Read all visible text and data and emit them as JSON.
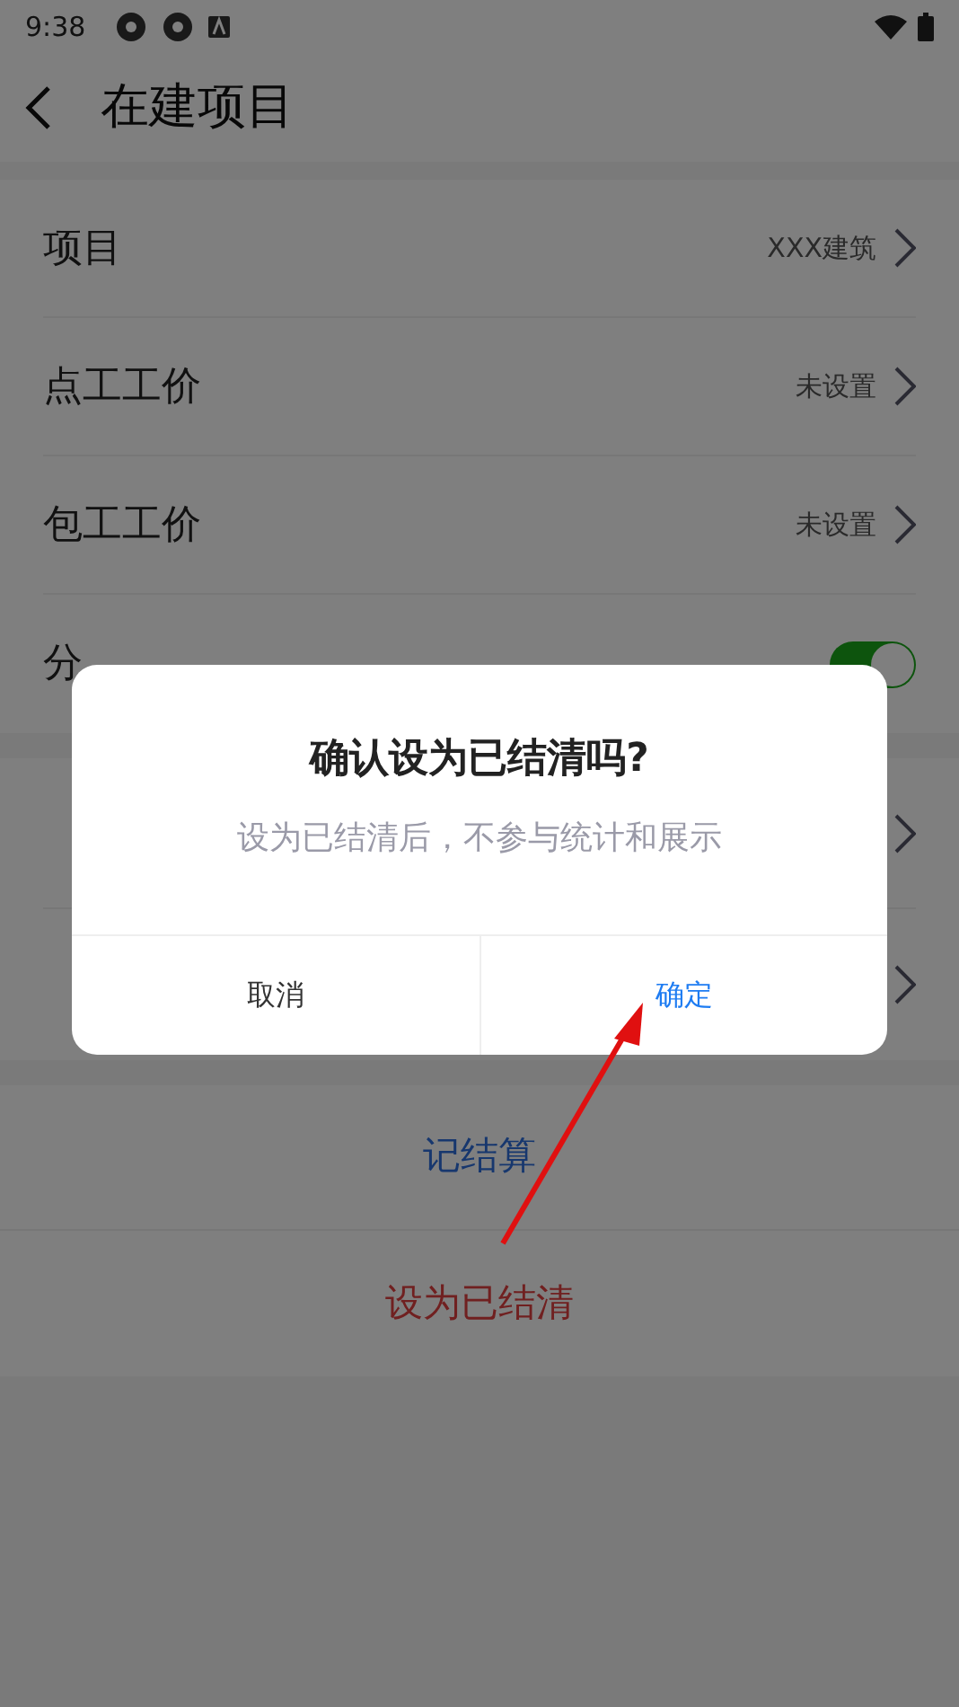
{
  "status_bar": {
    "time": "9:38"
  },
  "header": {
    "title": "在建项目"
  },
  "settings": [
    {
      "label": "项目",
      "value": "XXX建筑",
      "kind": "link"
    },
    {
      "label": "点工工价",
      "value": "未设置",
      "kind": "link"
    },
    {
      "label": "包工工价",
      "value": "未设置",
      "kind": "link"
    },
    {
      "label": "分",
      "kind": "toggle",
      "on": true
    }
  ],
  "actions": [
    {
      "label": "记结算",
      "kind": "primary"
    },
    {
      "label": "设为已结清",
      "kind": "danger"
    }
  ],
  "dialog": {
    "title": "确认设为已结清吗?",
    "message": "设为已结清后，不参与统计和展示",
    "buttons": [
      {
        "label": "取消",
        "kind": "cancel"
      },
      {
        "label": "确定",
        "kind": "confirm"
      }
    ]
  }
}
